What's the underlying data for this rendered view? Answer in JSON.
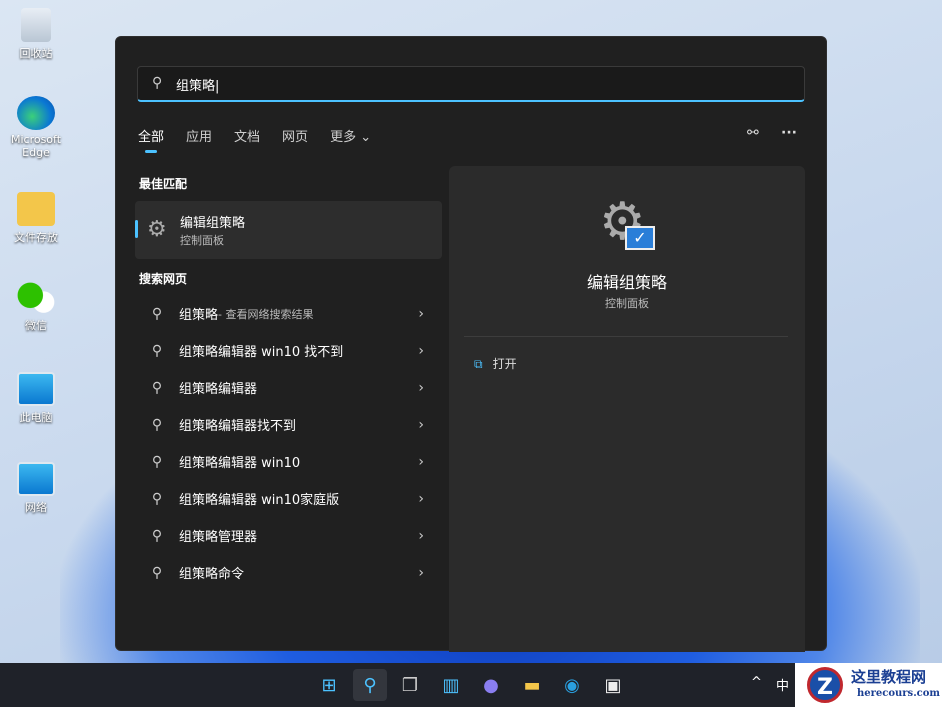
{
  "desktop": {
    "icons": [
      {
        "label": "回收站"
      },
      {
        "label": "Microsoft Edge"
      },
      {
        "label": "文件存放"
      },
      {
        "label": "微信"
      },
      {
        "label": "此电脑"
      },
      {
        "label": "网络"
      }
    ]
  },
  "search": {
    "value": "组策略"
  },
  "tabs": [
    {
      "label": "全部"
    },
    {
      "label": "应用"
    },
    {
      "label": "文档"
    },
    {
      "label": "网页"
    },
    {
      "label": "更多 ⌄"
    }
  ],
  "best_match": {
    "heading": "最佳匹配",
    "title": "编辑组策略",
    "subtitle": "控制面板"
  },
  "web": {
    "heading": "搜索网页",
    "items": [
      {
        "label": "组策略",
        "sub": " - 查看网络搜索结果"
      },
      {
        "label": "组策略编辑器 win10 找不到",
        "sub": ""
      },
      {
        "label": "组策略编辑器",
        "sub": ""
      },
      {
        "label": "组策略编辑器找不到",
        "sub": ""
      },
      {
        "label": "组策略编辑器 win10",
        "sub": ""
      },
      {
        "label": "组策略编辑器 win10家庭版",
        "sub": ""
      },
      {
        "label": "组策略管理器",
        "sub": ""
      },
      {
        "label": "组策略命令",
        "sub": ""
      }
    ]
  },
  "detail": {
    "title": "编辑组策略",
    "subtitle": "控制面板",
    "open_label": "打开"
  },
  "tray": {
    "chevron": "^",
    "ime": "中"
  },
  "watermark": {
    "name": "这里教程网",
    "url": "herecours.com"
  }
}
